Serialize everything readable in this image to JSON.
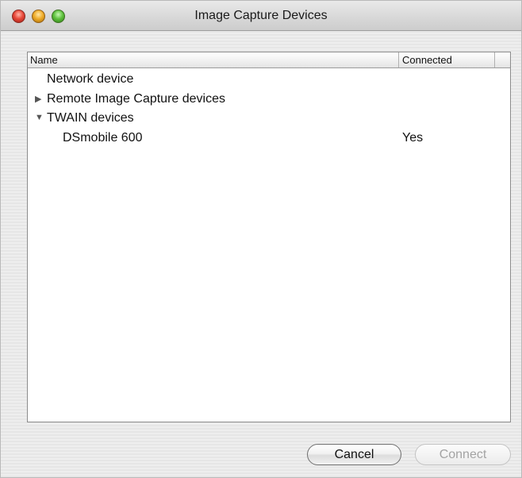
{
  "window": {
    "title": "Image Capture Devices"
  },
  "table": {
    "columns": {
      "name": "Name",
      "connected": "Connected"
    },
    "rows": [
      {
        "label": "Network device",
        "expandable": false,
        "connected": ""
      },
      {
        "label": "Remote Image Capture devices",
        "expandable": true,
        "expanded": false,
        "disclosure": "▶",
        "connected": ""
      },
      {
        "label": "TWAIN devices",
        "expandable": true,
        "expanded": true,
        "disclosure": "▼",
        "connected": ""
      },
      {
        "label": "DSmobile 600",
        "expandable": false,
        "connected": "Yes"
      }
    ]
  },
  "buttons": {
    "cancel_label": "Cancel",
    "connect_label": "Connect",
    "connect_enabled": false
  }
}
